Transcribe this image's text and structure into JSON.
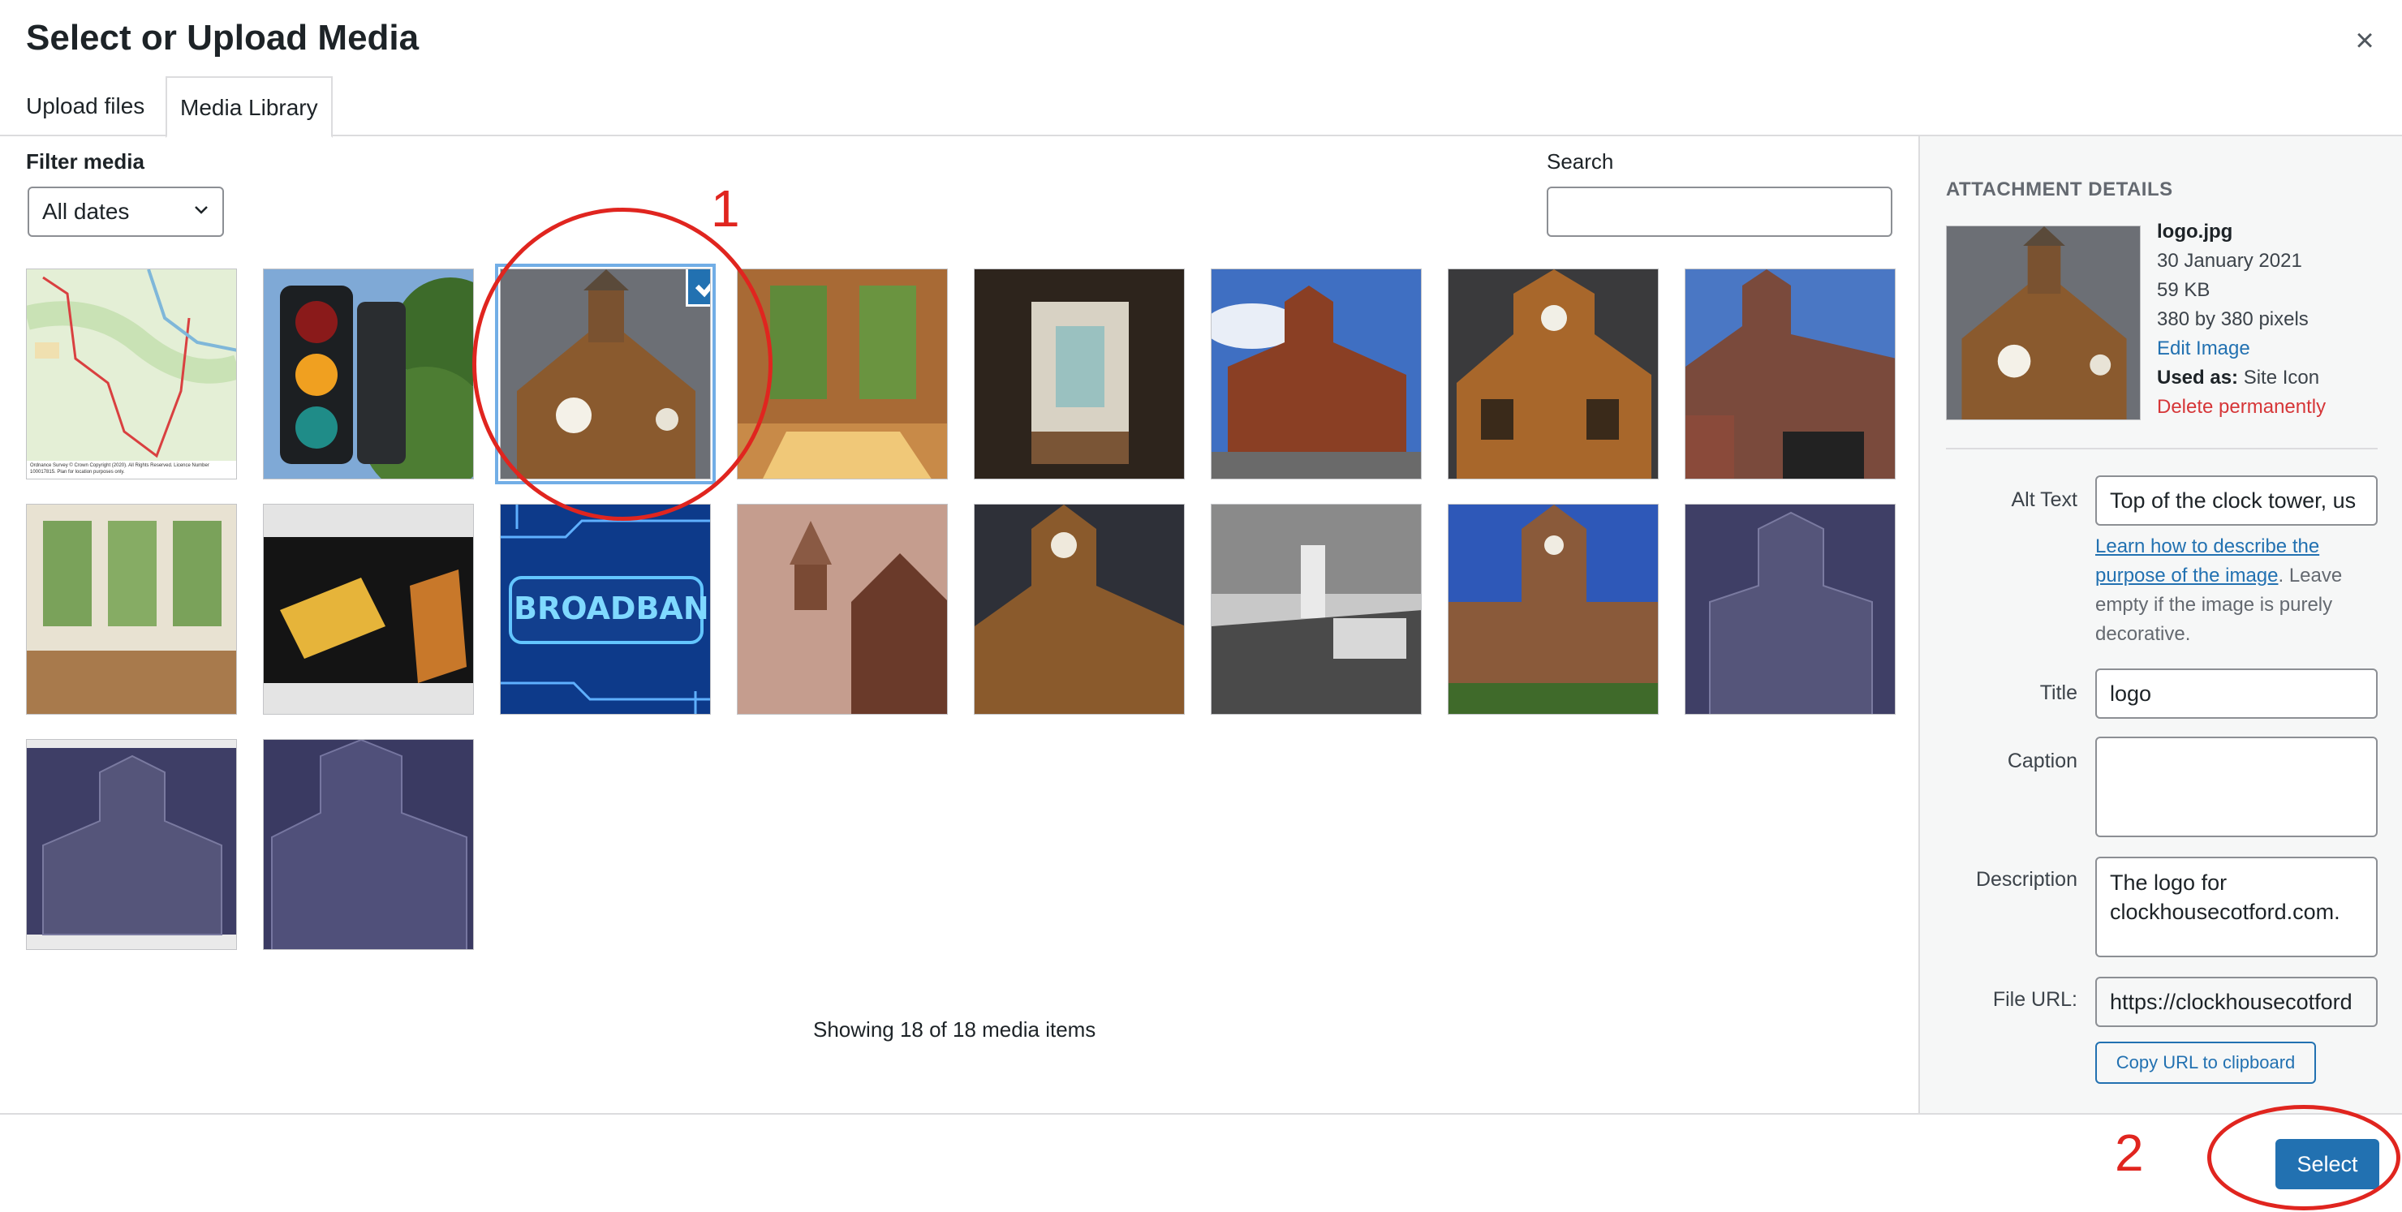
{
  "title": "Select or Upload Media",
  "tabs": [
    {
      "label": "Upload files",
      "active": false
    },
    {
      "label": "Media Library",
      "active": true
    }
  ],
  "filter": {
    "label": "Filter media",
    "date_value": "All dates"
  },
  "search": {
    "label": "Search",
    "value": ""
  },
  "grid": {
    "items": [
      {
        "name": "map"
      },
      {
        "name": "traffic-lights"
      },
      {
        "name": "logo",
        "selected": true
      },
      {
        "name": "room-windows"
      },
      {
        "name": "doorway"
      },
      {
        "name": "building-blue-sky"
      },
      {
        "name": "clock-tower-sunlit"
      },
      {
        "name": "building-gate"
      },
      {
        "name": "bay-window-room"
      },
      {
        "name": "network-cable"
      },
      {
        "name": "broadband",
        "text": "BROADBAND"
      },
      {
        "name": "tower-sepia"
      },
      {
        "name": "clock-tower-dark"
      },
      {
        "name": "old-photo-ward"
      },
      {
        "name": "tower-front"
      },
      {
        "name": "tower-purple-1"
      },
      {
        "name": "tower-purple-2"
      },
      {
        "name": "tower-purple-3"
      }
    ],
    "map_caption": "Ordnance Survey © Crown Copyright (2020). All Rights Reserved. Licence Number 100017815. Plan for location purposes only."
  },
  "showing": "Showing 18 of 18 media items",
  "annotations": [
    "1",
    "2"
  ],
  "details": {
    "heading": "ATTACHMENT DETAILS",
    "filename": "logo.jpg",
    "date": "30 January 2021",
    "size": "59 KB",
    "dimensions": "380 by 380 pixels",
    "edit_link": "Edit Image",
    "used_as_label": "Used as:",
    "used_as_value": "Site Icon",
    "delete_link": "Delete permanently",
    "alt_label": "Alt Text",
    "alt_value": "Top of the clock tower, us",
    "alt_help_link": "Learn how to describe the purpose of the image",
    "alt_help_text": ". Leave empty if the image is purely decorative.",
    "title_label": "Title",
    "title_value": "logo",
    "caption_label": "Caption",
    "caption_value": "",
    "description_label": "Description",
    "description_value": "The logo for clockhousecotford.com.",
    "url_label": "File URL:",
    "url_value": "https://clockhousecotford",
    "copy_button": "Copy URL to clipboard"
  },
  "footer": {
    "select_label": "Select"
  },
  "colors": {
    "accent": "#2271b1",
    "annotation": "#e0251f",
    "danger": "#d63638"
  }
}
